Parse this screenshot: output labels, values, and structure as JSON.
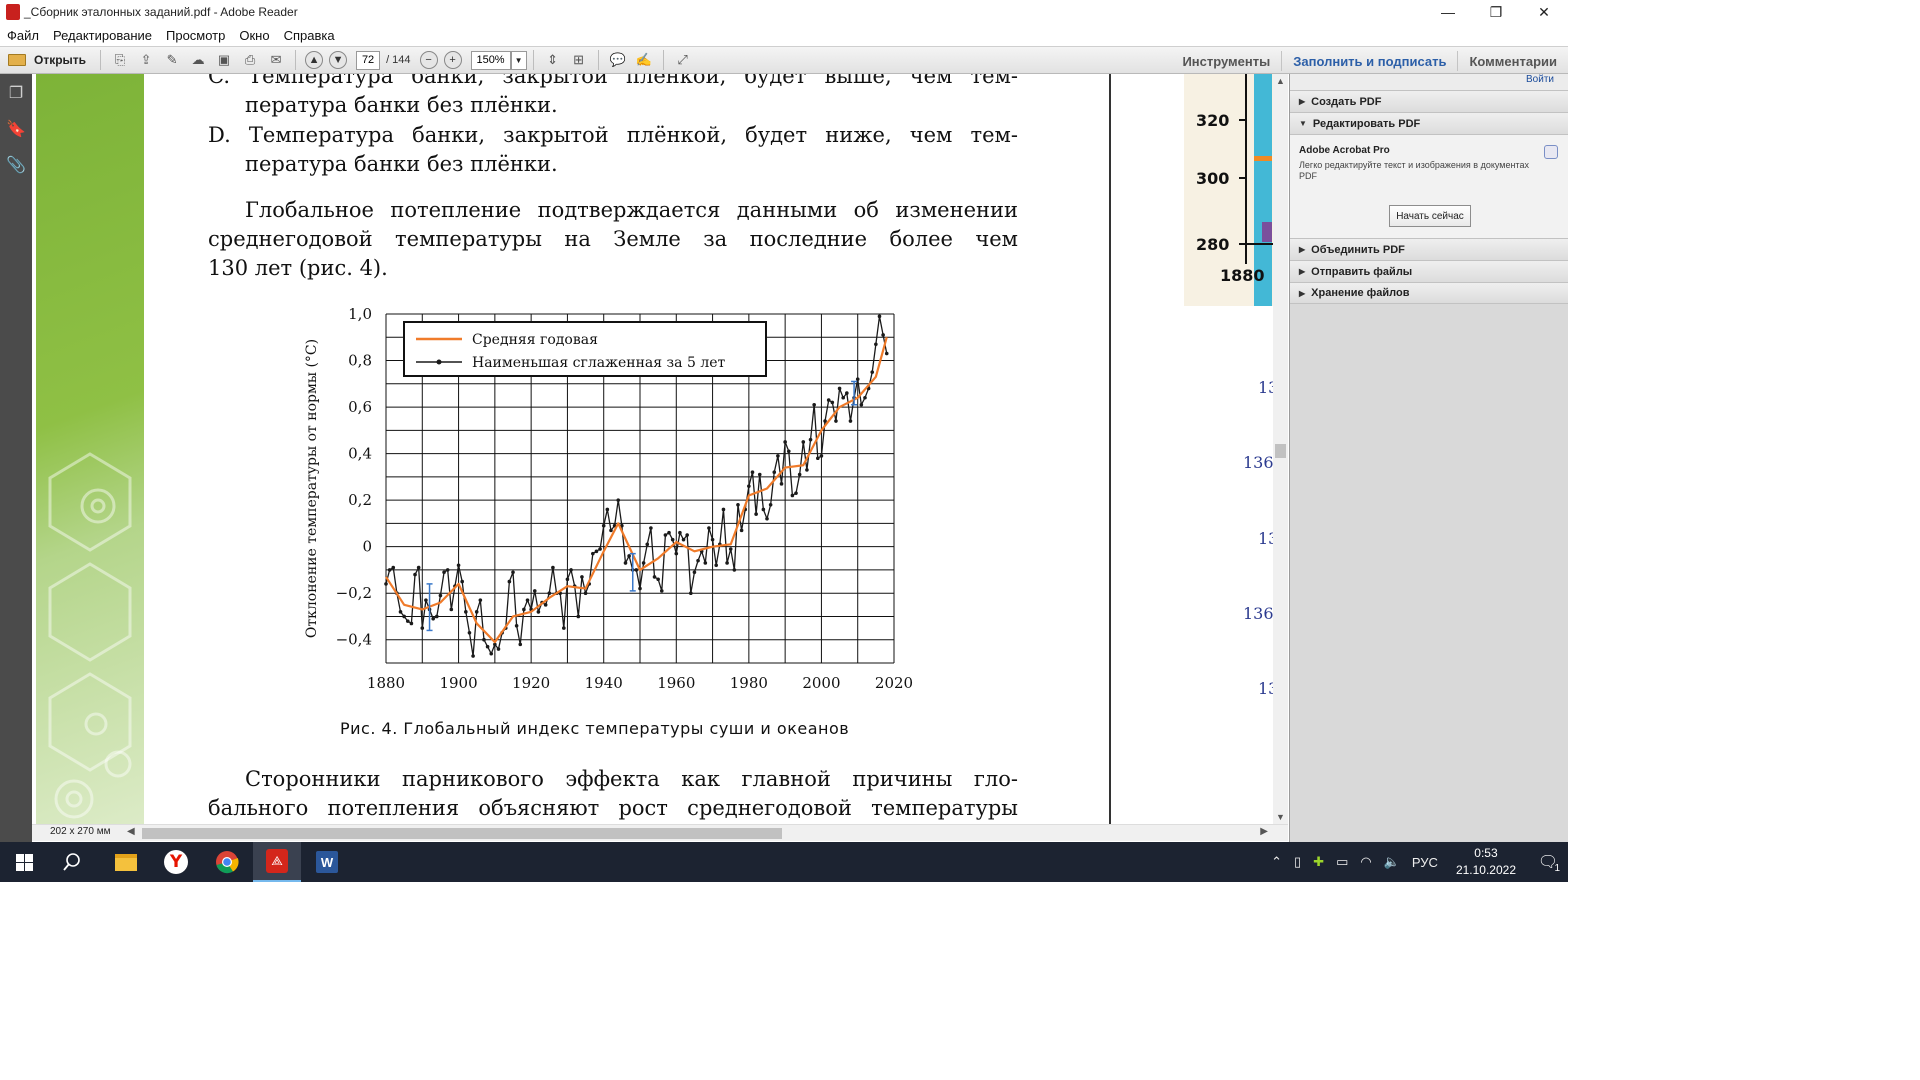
{
  "window": {
    "title": "_Сборник эталонных заданий.pdf - Adobe Reader",
    "minimize": "—",
    "restore": "❐",
    "close": "✕"
  },
  "menu": [
    "Файл",
    "Редактирование",
    "Просмотр",
    "Окно",
    "Справка"
  ],
  "toolbar": {
    "open_label": "Открыть",
    "page_current": "72",
    "page_total": "/ 144",
    "zoom": "150%",
    "tools": "Инструменты",
    "fill_sign": "Заполнить и подписать",
    "comments": "Комментарии"
  },
  "document": {
    "para_c": "C. Температура банки, закрытой плёнкой, будет выше, чем температура банки без плёнки.",
    "para_c_top": "C. Температура банки, закрытой пленкой, будет выше, чем тем-",
    "para_c_bottom": "пература банки без плёнки.",
    "para_d_top": "D. Температура банки, закрытой плёнкой, будет ниже, чем тем-",
    "para_d_bottom": "пература банки без плёнки.",
    "para_warming_1": "Глобальное потепление подтверждается данными об изменении",
    "para_warming_2": "среднегодовой температуры на Земле за последние более чем",
    "para_warming_3": "130 лет (рис. 4).",
    "caption": "Рис. 4. Глобальный индекс температуры суши и океанов",
    "para_bottom_1": "Сторонники парникового эффекта как главной причины гло-",
    "para_bottom_2": "бального потепления объясняют рост среднегодовой температуры",
    "page_size": "202 x 270 мм"
  },
  "right_page": {
    "ticks": [
      "320",
      "300",
      "280"
    ],
    "xtick": "1880",
    "page_numbers": [
      "13",
      "136",
      "13",
      "136",
      "13"
    ]
  },
  "chart_data": {
    "type": "line",
    "title": "",
    "xlabel": "",
    "ylabel": "Отклонение температуры от нормы (°C)",
    "xlim": [
      1880,
      2020
    ],
    "ylim": [
      -0.5,
      1.0
    ],
    "xticks": [
      "1880",
      "1900",
      "1920",
      "1940",
      "1960",
      "1980",
      "2000",
      "2020"
    ],
    "yticks": [
      "1,0",
      "0,8",
      "0,6",
      "0,4",
      "0,2",
      "0",
      "−0,2",
      "−0,4"
    ],
    "ytick_values": [
      1.0,
      0.8,
      0.6,
      0.4,
      0.2,
      0.0,
      -0.2,
      -0.4
    ],
    "grid": true,
    "legend_position": "top-left",
    "series": [
      {
        "name": "Средняя годовая",
        "color": "#f07b2a",
        "x": [
          1880,
          1885,
          1890,
          1895,
          1900,
          1905,
          1910,
          1915,
          1920,
          1925,
          1930,
          1935,
          1940,
          1944,
          1950,
          1955,
          1960,
          1965,
          1970,
          1975,
          1980,
          1985,
          1990,
          1995,
          2000,
          2005,
          2010,
          2015,
          2018
        ],
        "y": [
          -0.13,
          -0.25,
          -0.27,
          -0.24,
          -0.16,
          -0.33,
          -0.41,
          -0.3,
          -0.28,
          -0.22,
          -0.17,
          -0.18,
          -0.02,
          0.1,
          -0.1,
          -0.05,
          0.02,
          -0.02,
          0.0,
          0.01,
          0.22,
          0.25,
          0.34,
          0.35,
          0.5,
          0.6,
          0.64,
          0.73,
          0.9
        ]
      },
      {
        "name": "Наименьшая сглаженная за 5 лет",
        "color": "#1a1a1a",
        "x": [
          1880,
          1881,
          1882,
          1883,
          1884,
          1885,
          1886,
          1887,
          1888,
          1889,
          1890,
          1891,
          1892,
          1893,
          1894,
          1895,
          1896,
          1897,
          1898,
          1899,
          1900,
          1901,
          1902,
          1903,
          1904,
          1905,
          1906,
          1907,
          1908,
          1909,
          1910,
          1911,
          1912,
          1913,
          1914,
          1915,
          1916,
          1917,
          1918,
          1919,
          1920,
          1921,
          1922,
          1923,
          1924,
          1925,
          1926,
          1927,
          1928,
          1929,
          1930,
          1931,
          1932,
          1933,
          1934,
          1935,
          1936,
          1937,
          1938,
          1939,
          1940,
          1941,
          1942,
          1943,
          1944,
          1945,
          1946,
          1947,
          1948,
          1949,
          1950,
          1951,
          1952,
          1953,
          1954,
          1955,
          1956,
          1957,
          1958,
          1959,
          1960,
          1961,
          1962,
          1963,
          1964,
          1965,
          1966,
          1967,
          1968,
          1969,
          1970,
          1971,
          1972,
          1973,
          1974,
          1975,
          1976,
          1977,
          1978,
          1979,
          1980,
          1981,
          1982,
          1983,
          1984,
          1985,
          1986,
          1987,
          1988,
          1989,
          1990,
          1991,
          1992,
          1993,
          1994,
          1995,
          1996,
          1997,
          1998,
          1999,
          2000,
          2001,
          2002,
          2003,
          2004,
          2005,
          2006,
          2007,
          2008,
          2009,
          2010,
          2011,
          2012,
          2013,
          2014,
          2015,
          2016,
          2017,
          2018
        ],
        "y": [
          -0.16,
          -0.1,
          -0.09,
          -0.2,
          -0.28,
          -0.3,
          -0.32,
          -0.33,
          -0.12,
          -0.09,
          -0.35,
          -0.23,
          -0.27,
          -0.31,
          -0.3,
          -0.21,
          -0.11,
          -0.1,
          -0.27,
          -0.17,
          -0.08,
          -0.15,
          -0.28,
          -0.37,
          -0.47,
          -0.28,
          -0.23,
          -0.4,
          -0.43,
          -0.46,
          -0.42,
          -0.44,
          -0.37,
          -0.35,
          -0.15,
          -0.11,
          -0.34,
          -0.42,
          -0.27,
          -0.23,
          -0.27,
          -0.19,
          -0.28,
          -0.24,
          -0.25,
          -0.2,
          -0.09,
          -0.2,
          -0.2,
          -0.35,
          -0.14,
          -0.1,
          -0.17,
          -0.3,
          -0.13,
          -0.2,
          -0.16,
          -0.03,
          -0.02,
          -0.01,
          0.09,
          0.16,
          0.07,
          0.09,
          0.2,
          0.09,
          -0.07,
          -0.04,
          -0.1,
          -0.1,
          -0.18,
          -0.07,
          0.01,
          0.08,
          -0.13,
          -0.14,
          -0.19,
          0.05,
          0.06,
          0.03,
          -0.03,
          0.06,
          0.03,
          0.05,
          -0.2,
          -0.11,
          -0.06,
          -0.02,
          -0.07,
          0.08,
          0.03,
          -0.08,
          0.01,
          0.16,
          -0.07,
          -0.01,
          -0.1,
          0.18,
          0.07,
          0.16,
          0.26,
          0.32,
          0.14,
          0.31,
          0.16,
          0.12,
          0.18,
          0.32,
          0.39,
          0.27,
          0.45,
          0.41,
          0.22,
          0.23,
          0.31,
          0.45,
          0.33,
          0.46,
          0.61,
          0.38,
          0.39,
          0.54,
          0.63,
          0.62,
          0.54,
          0.68,
          0.64,
          0.66,
          0.54,
          0.64,
          0.72,
          0.61,
          0.64,
          0.68,
          0.75,
          0.87,
          0.99,
          0.91,
          0.83
        ]
      }
    ],
    "error_bars": [
      {
        "x": 1892,
        "center": -0.26,
        "half_width": 0.1
      },
      {
        "x": 1948,
        "center": -0.11,
        "half_width": 0.08
      },
      {
        "x": 2009,
        "center": 0.66,
        "half_width": 0.05
      }
    ]
  },
  "right_panel": {
    "login": "Войти",
    "sections": [
      "Создать PDF",
      "Редактировать PDF",
      "Объединить PDF",
      "Отправить файлы",
      "Хранение файлов"
    ],
    "product": "Adobe Acrobat Pro",
    "description": "Легко редактируйте текст и изображения в документах PDF",
    "start_button": "Начать сейчас"
  },
  "taskbar": {
    "language": "РУС",
    "time": "0:53",
    "date": "21.10.2022",
    "notifications": "1"
  }
}
